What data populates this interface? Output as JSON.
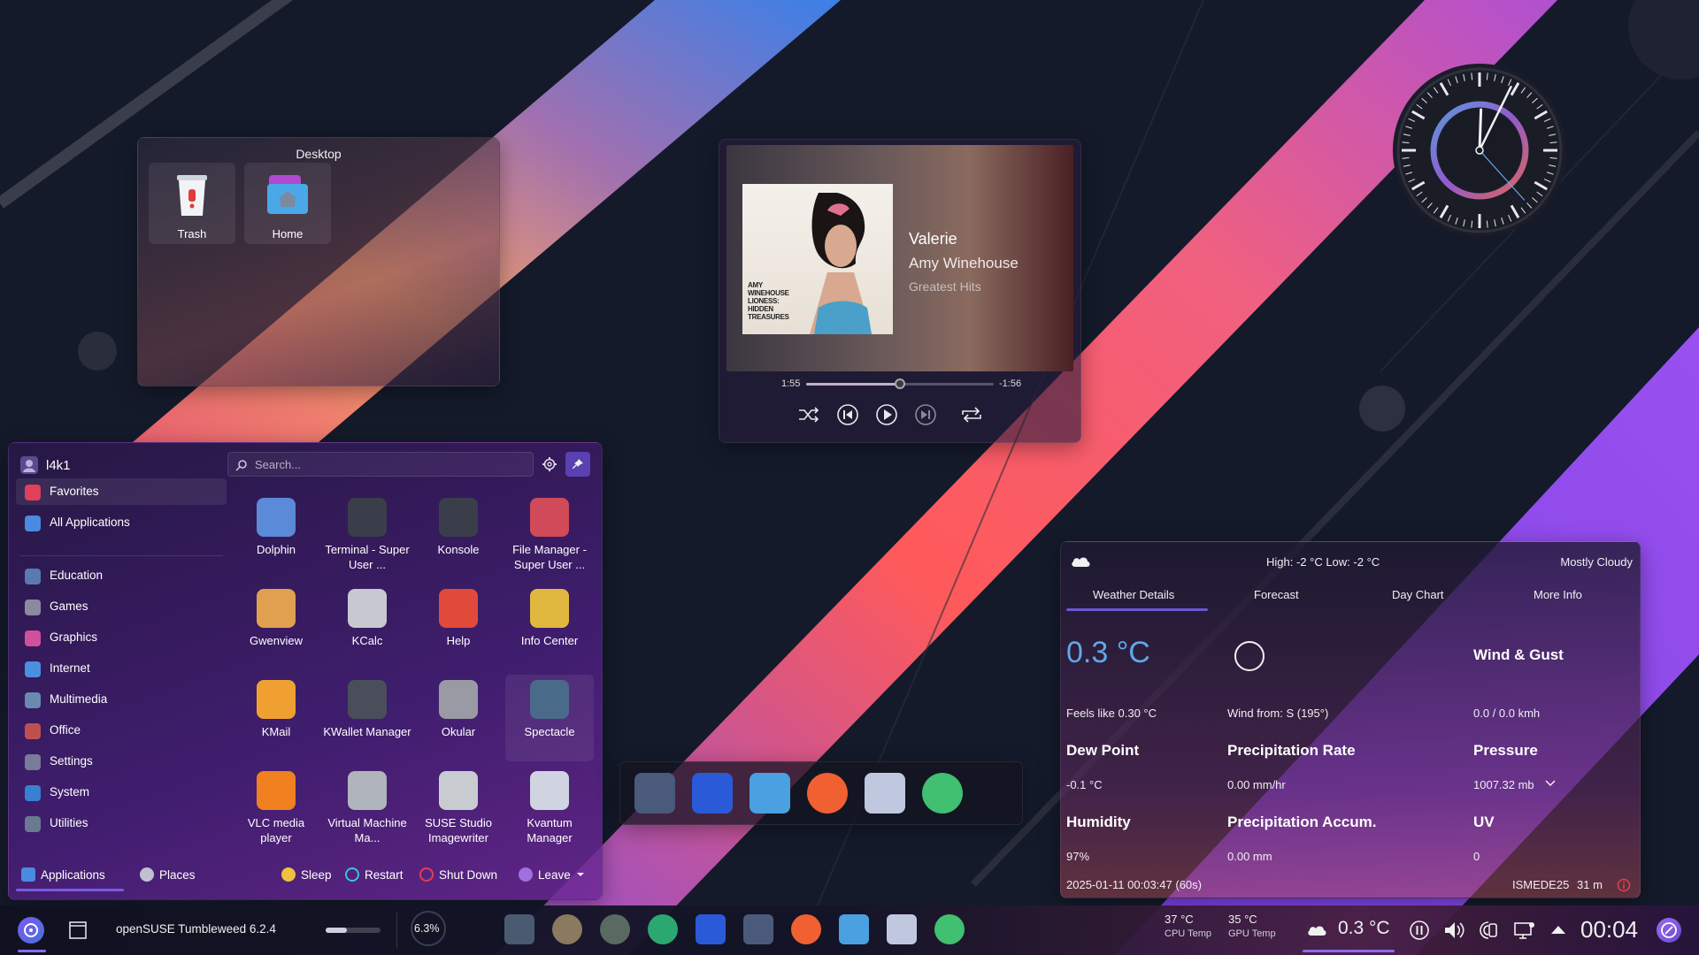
{
  "desktop_folder": {
    "title": "Desktop",
    "items": [
      {
        "label": "Trash",
        "icon": "trash-icon"
      },
      {
        "label": "Home",
        "icon": "home-folder-icon"
      }
    ]
  },
  "media_player": {
    "title": "Valerie",
    "artist": "Amy Winehouse",
    "album": "Greatest Hits",
    "art_text": "AMY WINEHOUSE LIONESS: HIDDEN TREASURES",
    "elapsed": "1:55",
    "remaining": "-1:56",
    "progress": 0.5,
    "controls": [
      "shuffle-icon",
      "previous-icon",
      "play-icon",
      "next-icon",
      "repeat-icon"
    ]
  },
  "clock": {
    "hour": 0,
    "minute": 4,
    "second": 23
  },
  "weather": {
    "summary": "High: -2 °C Low: -2 °C",
    "condition": "Mostly Cloudy",
    "tabs": [
      "Weather Details",
      "Forecast",
      "Day Chart",
      "More Info"
    ],
    "active_tab": "Weather Details",
    "temperature": "0.3 °C",
    "feels_like": "Feels like 0.30 °C",
    "wind_from": "Wind from: S (195°)",
    "wind_gust_label": "Wind & Gust",
    "wind_gust_value": "0.0 / 0.0 kmh",
    "dew_point_label": "Dew Point",
    "dew_point_value": "-0.1 °C",
    "precip_rate_label": "Precipitation Rate",
    "precip_rate_value": "0.00 mm/hr",
    "pressure_label": "Pressure",
    "pressure_value": "1007.32 mb",
    "humidity_label": "Humidity",
    "humidity_value": "97%",
    "precip_accum_label": "Precipitation Accum.",
    "precip_accum_value": "0.00 mm",
    "uv_label": "UV",
    "uv_value": "0",
    "timestamp": "2025-01-11 00:03:47 (60s)",
    "station": "ISMEDE25",
    "station_elevation": "31 m"
  },
  "launcher": {
    "username": "l4k1",
    "search_placeholder": "Search...",
    "categories": [
      {
        "label": "Favorites",
        "color": "#e0405a"
      },
      {
        "label": "All Applications",
        "color": "#4a8ae0"
      },
      {
        "label": "Education",
        "color": "#5a7ab0"
      },
      {
        "label": "Games",
        "color": "#8a8aa0"
      },
      {
        "label": "Graphics",
        "color": "#d0509a"
      },
      {
        "label": "Internet",
        "color": "#4a90e0"
      },
      {
        "label": "Multimedia",
        "color": "#6a8ab0"
      },
      {
        "label": "Office",
        "color": "#c05050"
      },
      {
        "label": "Settings",
        "color": "#7a7a9a"
      },
      {
        "label": "System",
        "color": "#3a80d0"
      },
      {
        "label": "Utilities",
        "color": "#6a7a90"
      }
    ],
    "apps": [
      {
        "label": "Dolphin",
        "color": "#5a8ad8"
      },
      {
        "label": "Terminal - Super User ...",
        "color": "#3a3e4a"
      },
      {
        "label": "Konsole",
        "color": "#3a3e4a"
      },
      {
        "label": "File Manager - Super User ...",
        "color": "#d04a5a"
      },
      {
        "label": "Gwenview",
        "color": "#e0a050"
      },
      {
        "label": "KCalc",
        "color": "#c8c8d0"
      },
      {
        "label": "Help",
        "color": "#e04a3a"
      },
      {
        "label": "Info Center",
        "color": "#e0b840"
      },
      {
        "label": "KMail",
        "color": "#f0a030"
      },
      {
        "label": "KWallet Manager",
        "color": "#4a4e5a"
      },
      {
        "label": "Okular",
        "color": "#9a9aa4"
      },
      {
        "label": "Spectacle",
        "color": "#4a6a8a"
      },
      {
        "label": "VLC media player",
        "color": "#f08020"
      },
      {
        "label": "Virtual Machine Ma...",
        "color": "#b0b4bc"
      },
      {
        "label": "SUSE Studio Imagewriter",
        "color": "#c8ccd0"
      },
      {
        "label": "Kvantum Manager",
        "color": "#d0d4e0"
      }
    ],
    "footer": {
      "applications": "Applications",
      "places": "Places",
      "sleep": "Sleep",
      "restart": "Restart",
      "shutdown": "Shut Down",
      "leave": "Leave"
    }
  },
  "dock": {
    "icons": [
      "settings-sliders-icon",
      "discover-store-icon",
      "dolphin-file-manager-icon",
      "firefox-icon",
      "spectacle-screenshot-icon",
      "clock-app-icon"
    ]
  },
  "taskbar": {
    "os_label": "openSUSE Tumbleweed 6.2.4",
    "cpu_usage": "6.3%",
    "cpu_temp": "37 °C",
    "cpu_temp_label": "CPU Temp",
    "gpu_temp": "35 °C",
    "gpu_temp_label": "GPU Temp",
    "weather_temp": "0.3 °C",
    "clock": "00:04",
    "app_icons": [
      "system-monitor-icon",
      "gimp-icon",
      "shutter-icon",
      "mastodon-icon",
      "discover-store-icon",
      "settings-sliders-icon",
      "firefox-icon",
      "dolphin-file-manager-icon",
      "spectacle-screenshot-icon",
      "clock-app-icon"
    ]
  }
}
